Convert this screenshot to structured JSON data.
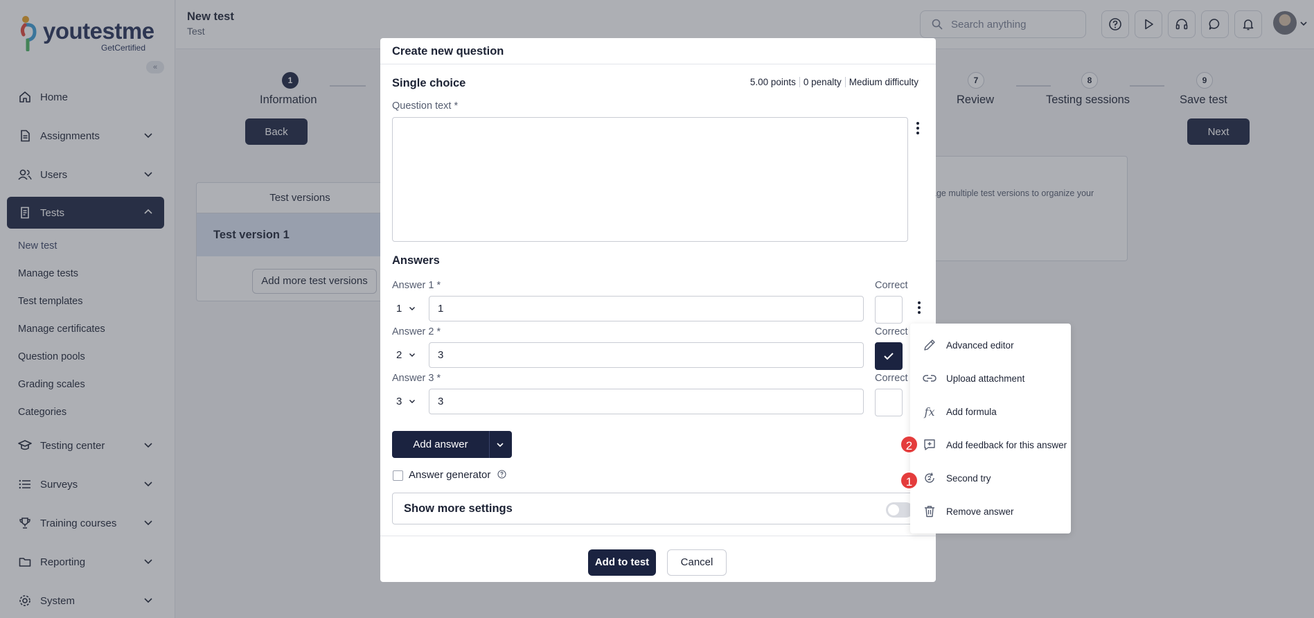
{
  "brand": {
    "name": "youtestme",
    "sub": "GetCertified"
  },
  "sidebar": {
    "collapse_icon": "«",
    "items": [
      {
        "label": "Home"
      },
      {
        "label": "Assignments"
      },
      {
        "label": "Users"
      },
      {
        "label": "Tests"
      },
      {
        "label": "Testing center"
      },
      {
        "label": "Surveys"
      },
      {
        "label": "Training courses"
      },
      {
        "label": "Reporting"
      },
      {
        "label": "System"
      }
    ],
    "sub_items": [
      {
        "label": "New test"
      },
      {
        "label": "Manage tests"
      },
      {
        "label": "Test templates"
      },
      {
        "label": "Manage certificates"
      },
      {
        "label": "Question pools"
      },
      {
        "label": "Grading scales"
      },
      {
        "label": "Categories"
      }
    ]
  },
  "header": {
    "title": "New test",
    "subtitle": "Test",
    "search_placeholder": "Search anything"
  },
  "stepper": {
    "steps": [
      {
        "num": "1",
        "label": "Information"
      },
      {
        "num": "7",
        "label": "Review"
      },
      {
        "num": "8",
        "label": "Testing sessions"
      },
      {
        "num": "9",
        "label": "Save test"
      }
    ],
    "back_label": "Back",
    "next_label": "Next"
  },
  "test_versions": {
    "header": "Test versions",
    "row": "Test version 1",
    "add_label": "Add more test versions",
    "info_text": "age multiple test versions to organize your"
  },
  "modal": {
    "title": "Create new question",
    "question_type": "Single choice",
    "meta": [
      "5.00 points",
      "0 penalty",
      "Medium difficulty"
    ],
    "question_text_label": "Question text *",
    "answers_title": "Answers",
    "correct_label": "Correct",
    "answers": [
      {
        "label": "Answer 1 *",
        "order": "1",
        "value": "1",
        "correct": false
      },
      {
        "label": "Answer 2 *",
        "order": "2",
        "value": "3",
        "correct": true
      },
      {
        "label": "Answer 3 *",
        "order": "3",
        "value": "3",
        "correct": false
      }
    ],
    "add_answer_label": "Add answer",
    "answer_generator_label": "Answer generator",
    "show_more_settings_label": "Show more settings",
    "add_to_test_label": "Add to test",
    "cancel_label": "Cancel"
  },
  "menu": {
    "items": [
      {
        "label": "Advanced editor",
        "icon": "pencil-icon"
      },
      {
        "label": "Upload attachment",
        "icon": "link-icon"
      },
      {
        "label": "Add formula",
        "icon": "fx-icon"
      },
      {
        "label": "Add feedback for this answer",
        "icon": "feedback-icon"
      },
      {
        "label": "Second try",
        "icon": "retry-icon"
      },
      {
        "label": "Remove answer",
        "icon": "trash-icon"
      }
    ],
    "badges": [
      "2",
      "1"
    ],
    "fx_glyph": "fx"
  },
  "colors": {
    "navy": "#1b2340",
    "badge_red": "#e43c3c",
    "selected_row": "#dbe4f3"
  }
}
